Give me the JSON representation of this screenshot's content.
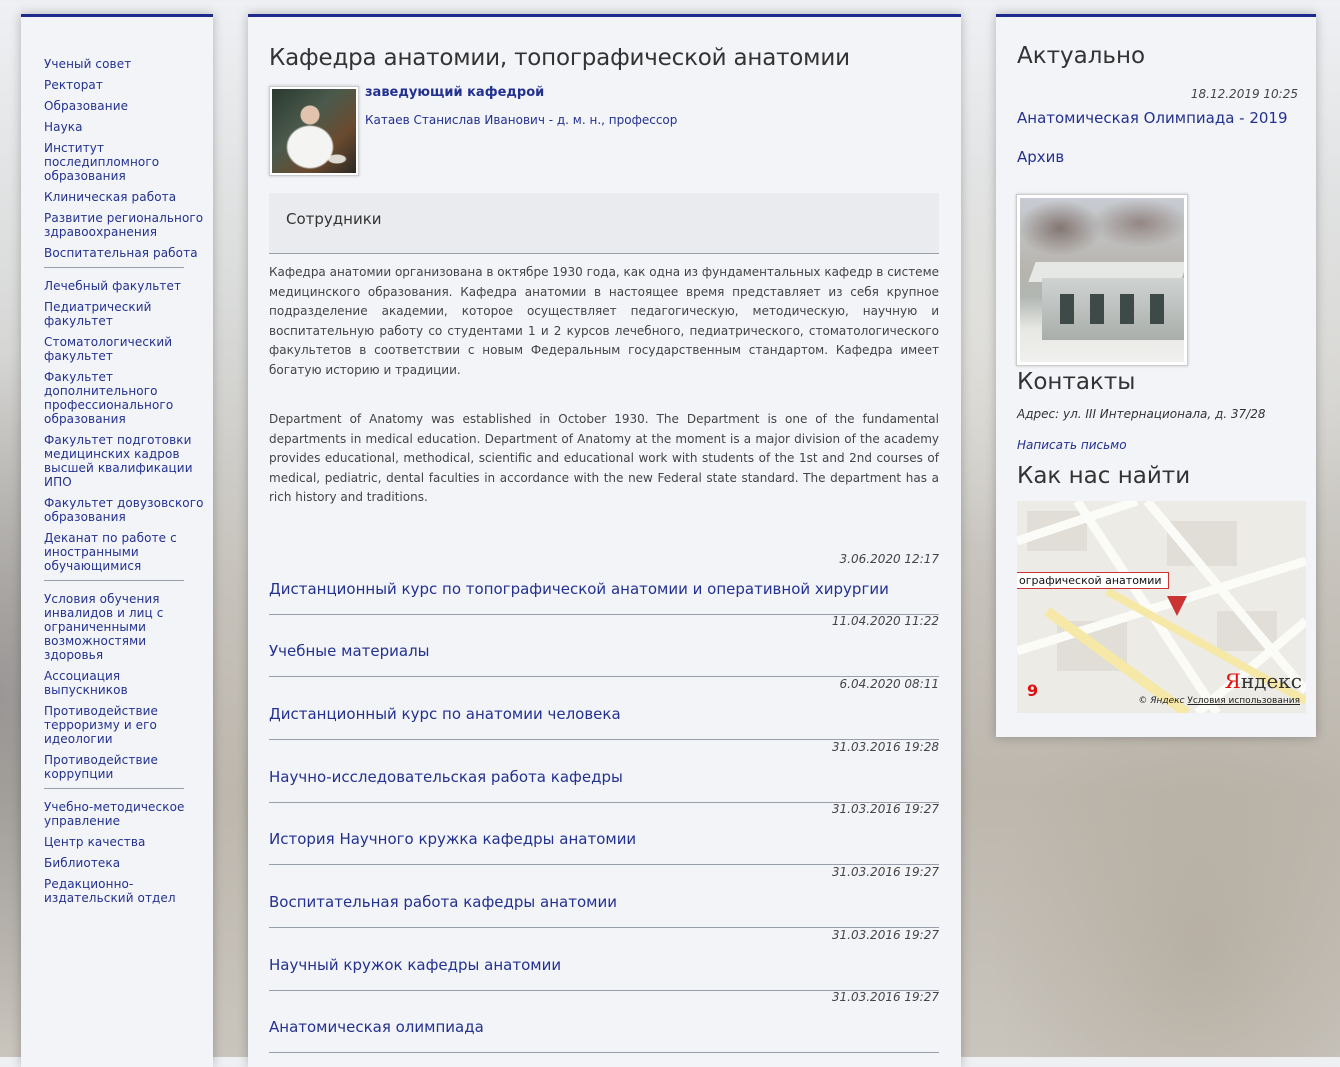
{
  "nav": {
    "items": [
      "Ученый совет",
      "Ректорат",
      "Образование",
      "Наука",
      "Институт последипломного образования",
      "Клиническая работа",
      "Развитие регионального здравоохранения",
      "Воспитательная работа",
      "Лечебный факультет",
      "Педиатрический факультет",
      "Стоматологический факультет",
      "Факультет дополнительного профессионального образования",
      "Факультет подготовки медицинских кадров высшей квалификации ИПО",
      "Факультет довузовского образования",
      "Деканат по работе с иностранными обучающимися",
      "Условия обучения инвалидов и лиц с ограниченными возможностями здоровья",
      "Ассоциация выпускников",
      "Противодействие терроризму и его идеологии",
      "Противодействие коррупции",
      "Учебно-методическое управление",
      "Центр качества",
      "Библиотека",
      "Редакционно-издательский отдел"
    ]
  },
  "main": {
    "title": "Кафедра анатомии, топографической анатомии",
    "head_role": "заведующий кафедрой",
    "head_name": "Катаев Станислав Иванович - д. м. н., профессор",
    "staff_label": "Сотрудники",
    "para_ru": "Кафедра анатомии организована в октябре 1930 года, как одна из фундаментальных кафедр в системе медицинского образования. Кафедра анатомии в настоящее время представляет из себя крупное подразделение академии, которое осуществляет педагогическую, методическую, научную и воспитательную работу со студентами 1 и 2 курсов лечебного, педиатрического, стоматологического факультетов в соответствии с новым Федеральным государственным стандартом. Кафедра имеет богатую историю и традиции.",
    "para_en": "Department of Anatomy was established in October 1930. The Department is one of the fundamental departments in medical education. Department of Anatomy at the moment is a major division of the academy provides educational, methodical, scientific and educational work with students of the 1st and 2nd courses of medical, pediatric, dental faculties in accordance with the new Federal state standard. The department has a rich history and traditions.",
    "news": [
      {
        "date": "3.06.2020 12:17",
        "title": "Дистанционный курс по топографической анатомии и оперативной хирургии"
      },
      {
        "date": "11.04.2020 11:22",
        "title": "Учебные материалы"
      },
      {
        "date": "6.04.2020 08:11",
        "title": "Дистанционный курс по анатомии человека"
      },
      {
        "date": "31.03.2016 19:28",
        "title": "Научно-исследовательская работа кафедры"
      },
      {
        "date": "31.03.2016 19:27",
        "title": "История Научного кружка кафедры анатомии"
      },
      {
        "date": "31.03.2016 19:27",
        "title": "Воспитательная работа кафедры анатомии"
      },
      {
        "date": "31.03.2016 19:27",
        "title": "Научный кружок кафедры анатомии"
      },
      {
        "date": "31.03.2016 19:27",
        "title": "Анатомическая олимпиада"
      }
    ]
  },
  "sidebar": {
    "actual_title": "Актуально",
    "actual_date": "18.12.2019 10:25",
    "actual_link": "Анатомическая Олимпиада - 2019",
    "archive": "Архив",
    "contacts_title": "Контакты",
    "address": "Адрес: ул. III Интернационала, д. 37/28",
    "write_letter": "Написать письмо",
    "find_title": "Как нас найти",
    "map_label": "ографической анатомии",
    "map_logo_y": "Я",
    "map_logo_rest": "ндекс",
    "map_copyright": "© Яндекс",
    "map_terms": "Условия использования"
  }
}
